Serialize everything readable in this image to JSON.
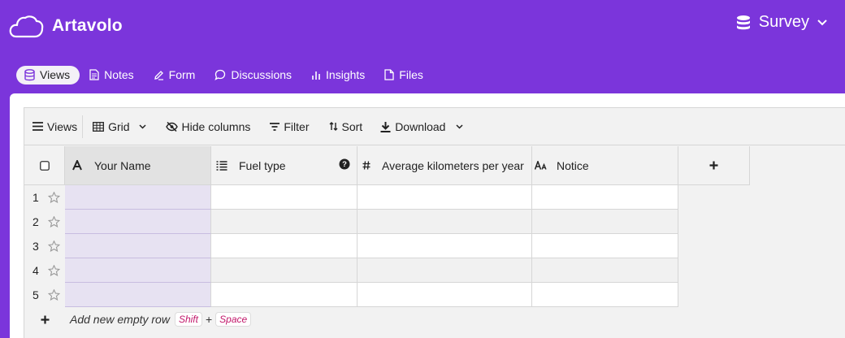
{
  "app": {
    "name": "Artavolo"
  },
  "base": {
    "name": "Survey"
  },
  "nav": {
    "tabs": [
      {
        "label": "Views",
        "icon": "database-icon",
        "active": true
      },
      {
        "label": "Notes",
        "icon": "document-icon"
      },
      {
        "label": "Form",
        "icon": "pencil-icon"
      },
      {
        "label": "Discussions",
        "icon": "speech-bubble-icon"
      },
      {
        "label": "Insights",
        "icon": "bar-chart-icon"
      },
      {
        "label": "Files",
        "icon": "file-icon"
      }
    ]
  },
  "toolbar": {
    "views": "Views",
    "grid": "Grid",
    "hide_columns": "Hide columns",
    "filter": "Filter",
    "sort": "Sort",
    "download": "Download"
  },
  "table": {
    "columns": [
      {
        "label": "Your Name",
        "icon": "text-A-icon"
      },
      {
        "label": "Fuel type",
        "icon": "list-icon",
        "help": true
      },
      {
        "label": "Average kilometers per year",
        "icon": "hash-icon"
      },
      {
        "label": "Notice",
        "icon": "text-Aa-icon"
      }
    ],
    "row_numbers": [
      "1",
      "2",
      "3",
      "4",
      "5"
    ]
  },
  "add_row": {
    "label": "Add new empty row",
    "shortcut_key1": "Shift",
    "shortcut_plus": "+",
    "shortcut_key2": "Space"
  },
  "colors": {
    "brand": "#7b35db",
    "name_column": "#e7e2f2",
    "shortcut": "#c2186b"
  }
}
